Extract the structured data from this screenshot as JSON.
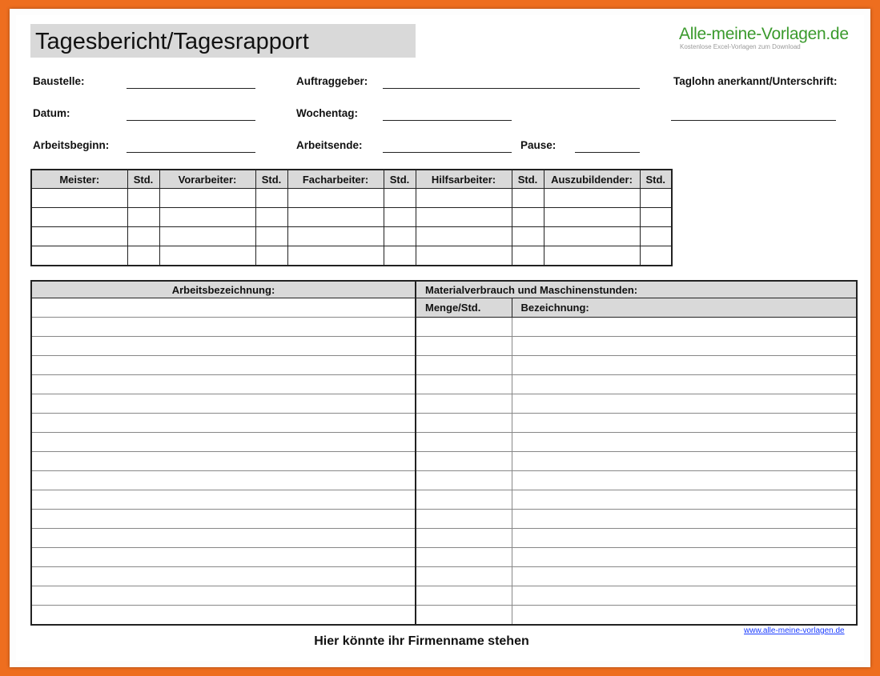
{
  "title": "Tagesbericht/Tagesrapport",
  "brand": {
    "name": "Alle-meine-Vorlagen.de",
    "tagline": "Kostenlose Excel-Vorlagen zum Download",
    "color": "#3a9a2c"
  },
  "fields": {
    "baustelle": "Baustelle:",
    "auftraggeber": "Auftraggeber:",
    "taglohn": "Taglohn anerkannt/Unterschrift:",
    "datum": "Datum:",
    "wochentag": "Wochentag:",
    "arbeitsbeginn": "Arbeitsbeginn:",
    "arbeitsende": "Arbeitsende:",
    "pause": "Pause:"
  },
  "staff_table": {
    "headers": [
      "Meister:",
      "Std.",
      "Vorarbeiter:",
      "Std.",
      "Facharbeiter:",
      "Std.",
      "Hilfsarbeiter:",
      "Std.",
      "Auszubildender:",
      "Std."
    ]
  },
  "work_table": {
    "col1_header": "Arbeitsbezeichnung:",
    "col2_header": "Materialverbrauch und Maschinenstunden:",
    "sub_qty": "Menge/Std.",
    "sub_desc": "Bezeichnung:"
  },
  "footer": {
    "company": "Hier könnte ihr Firmenname stehen",
    "link": "www.alle-meine-vorlagen.de"
  },
  "colors": {
    "frame": "#ee6e1f",
    "header_fill": "#d9d9d9",
    "link": "#1a3cff"
  }
}
